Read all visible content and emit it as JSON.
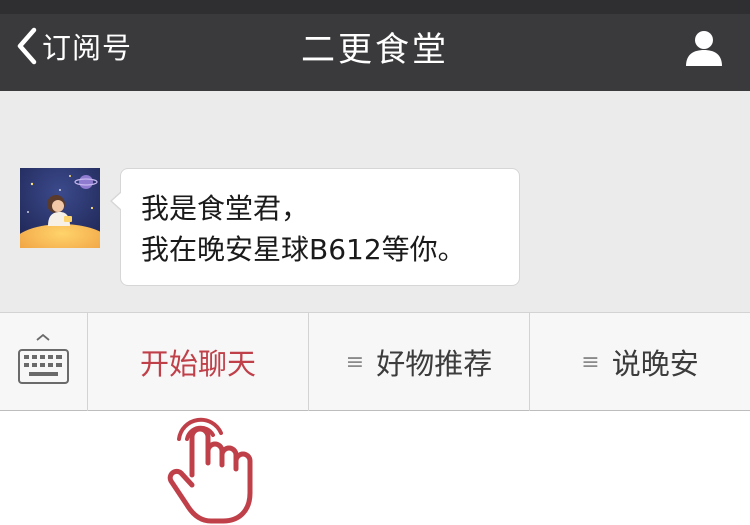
{
  "header": {
    "back_label": "订阅号",
    "title": "二更食堂"
  },
  "chat": {
    "message_line1": "我是食堂君，",
    "message_line2": "我在晚安星球B612等你。"
  },
  "menu": {
    "items": [
      {
        "label": "开始聊天",
        "icon": "",
        "active": true
      },
      {
        "label": "好物推荐",
        "icon": "list-icon",
        "icon_glyph": "≡"
      },
      {
        "label": "说晚安",
        "icon": "list-icon",
        "icon_glyph": "≡"
      }
    ]
  },
  "colors": {
    "header_bg": "#3a3a3c",
    "chat_bg": "#ebebeb",
    "accent": "#c0404a",
    "hand": "#c0404a"
  },
  "icons": {
    "back": "chevron-left-icon",
    "profile": "person-icon",
    "keyboard": "keyboard-icon",
    "pointer": "pointing-hand-icon"
  }
}
